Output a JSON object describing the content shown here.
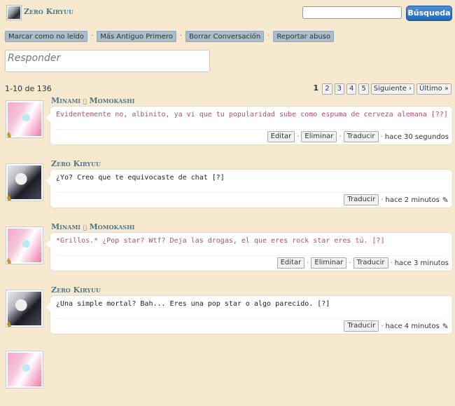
{
  "header": {
    "username": "Zero Kiryuu",
    "search_placeholder": "",
    "search_button": "Búsqueda"
  },
  "actions": [
    "Marcar como no leído",
    "Más Antiguo Primero",
    "Borrar Conversación",
    "Reportar abuso"
  ],
  "reply": {
    "placeholder": "Responder"
  },
  "pagination": {
    "count_text": "1-10 de 136",
    "current": "1",
    "pages": [
      "2",
      "3",
      "4",
      "5"
    ],
    "next": "Siguiente ›",
    "last": "Último »"
  },
  "posts": [
    {
      "author": "Minami ღ Momokashi",
      "avatar": "pink-hair-avatar",
      "text": "Evidentemente no, albinito, ya vi que tu popularidad sube como espuma de cerveza alemana [??]",
      "text_color": "#b24a7a",
      "buttons": [
        "Editar",
        "Eliminar",
        "Traducir"
      ],
      "time": "hace 30 segundos"
    },
    {
      "author": "Zero Kiryuu",
      "avatar": "silver-hair-avatar",
      "text": "¿Yo? Creo que te equivocaste de chat [?]",
      "text_color": "#222222",
      "buttons": [
        "Traducir"
      ],
      "time": "hace 2 minutos"
    },
    {
      "author": "Minami ღ Momokashi",
      "avatar": "pink-hair-avatar",
      "text": "*Grillos.* ¿Pop star? Wtf? Deja las drogas, el que eres rock star eres tú. [?]",
      "text_color": "#b24a7a",
      "buttons": [
        "Editar",
        "Eliminar",
        "Traducir"
      ],
      "time": "hace 3 minutos"
    },
    {
      "author": "Zero Kiryuu",
      "avatar": "silver-hair-avatar",
      "text": "¿Una simple mortal? Bah... Eres una pop star o algo parecido. [?]",
      "text_color": "#222222",
      "buttons": [
        "Traducir"
      ],
      "time": "hace 4 minutos"
    }
  ]
}
